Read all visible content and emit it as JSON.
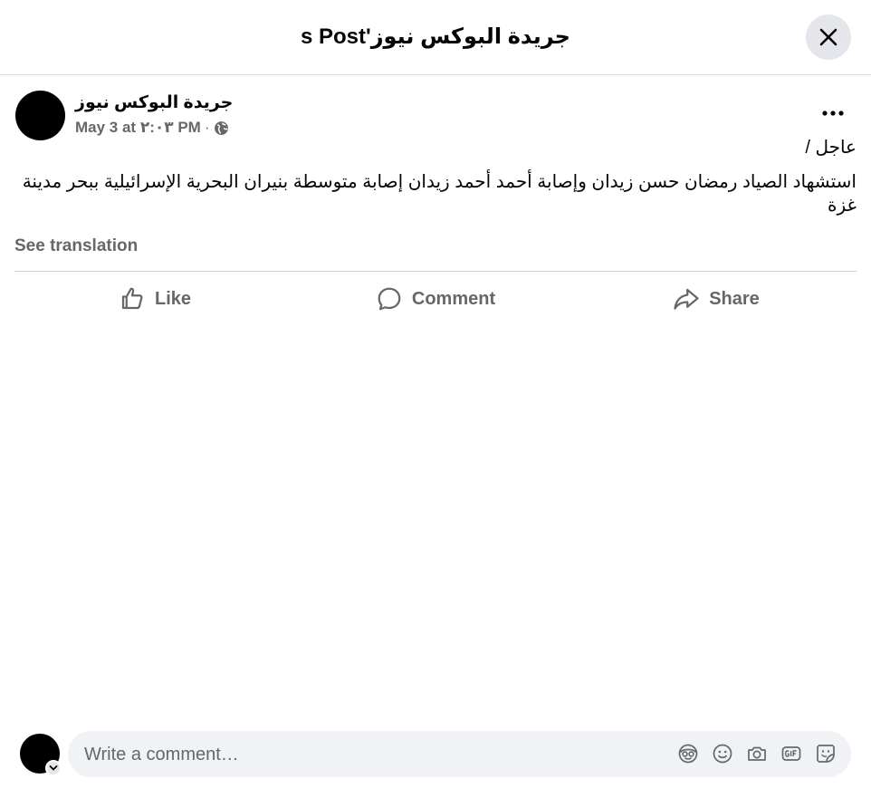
{
  "dialog": {
    "title": "جريدة البوكس نيوز's Post"
  },
  "post": {
    "page_name": "جريدة البوكس نيوز",
    "timestamp": "May 3 at ٢:٠٣ PM",
    "separator": "·",
    "privacy_icon": "globe-icon",
    "text_line1": "عاجل /",
    "text_line2": "استشهاد الصياد رمضان حسن زيدان وإصابة أحمد أحمد زيدان إصابة متوسطة بنيران البحرية الإسرائيلية ببحر مدينة غزة",
    "see_translation": "See translation"
  },
  "actions": {
    "like": "Like",
    "comment": "Comment",
    "share": "Share"
  },
  "composer": {
    "placeholder": "Write a comment…",
    "tools": [
      "avatar-sticker-icon",
      "emoji-icon",
      "camera-icon",
      "gif-icon",
      "sticker-icon"
    ]
  },
  "colors": {
    "text_primary": "#050505",
    "text_secondary": "#65676b",
    "close_bg": "#e4e6eb",
    "input_bg": "#f0f2f5",
    "divider": "#ced0d4"
  }
}
